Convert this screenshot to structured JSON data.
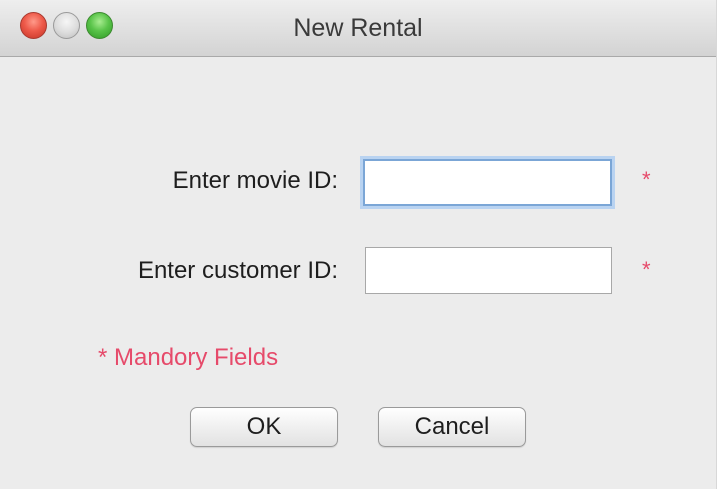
{
  "window": {
    "title": "New Rental",
    "controls": {
      "close": "close-icon",
      "minimize": "minimize-icon",
      "zoom": "zoom-icon"
    }
  },
  "form": {
    "movie_id_label": "Enter movie ID:",
    "movie_id_value": "",
    "customer_id_label": "Enter customer ID:",
    "customer_id_value": "",
    "required_marker": "*",
    "mandatory_note": "* Mandory Fields"
  },
  "buttons": {
    "ok_label": "OK",
    "cancel_label": "Cancel"
  },
  "colors": {
    "required": "#e64a6a",
    "focus_ring": "#7ba6d6"
  }
}
